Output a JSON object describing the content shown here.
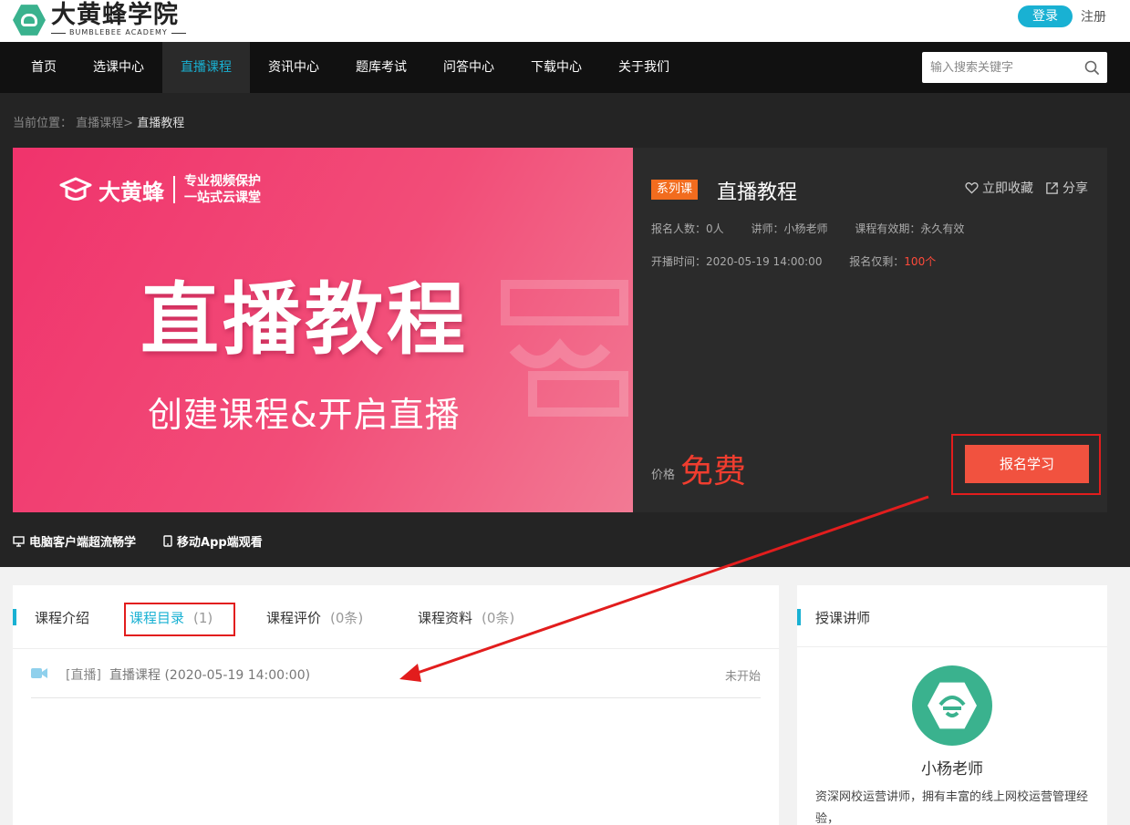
{
  "header": {
    "logo_cn": "大黄蜂学院",
    "logo_en": "BUMBLEBEE ACADEMY",
    "login_label": "登录",
    "register_label": "注册"
  },
  "nav": {
    "items": [
      {
        "label": "首页",
        "active": false
      },
      {
        "label": "选课中心",
        "active": false
      },
      {
        "label": "直播课程",
        "active": true
      },
      {
        "label": "资讯中心",
        "active": false
      },
      {
        "label": "题库考试",
        "active": false
      },
      {
        "label": "问答中心",
        "active": false
      },
      {
        "label": "下载中心",
        "active": false
      },
      {
        "label": "关于我们",
        "active": false
      }
    ],
    "search_placeholder": "输入搜索关键字"
  },
  "breadcrumb": {
    "prefix": "当前位置：",
    "parent": "直播课程>",
    "current": "直播教程"
  },
  "banner": {
    "brand": "大黄蜂",
    "tagline_1": "专业视频保护",
    "tagline_2": "一站式云课堂",
    "title": "直播教程",
    "subtitle": "创建课程&开启直播"
  },
  "course": {
    "series_tag": "系列课",
    "title": "直播教程",
    "favorite_label": "立即收藏",
    "share_label": "分享",
    "enrolled": "报名人数：0人",
    "teacher": "讲师：小杨老师",
    "validity": "课程有效期：永久有效",
    "start_time": "开播时间：2020-05-19 14:00:00",
    "remaining_label": "报名仅剩：",
    "remaining_value": "100个",
    "price_label": "价格",
    "price": "免费",
    "enroll_label": "报名学习"
  },
  "clients": {
    "pc": "电脑客户端超流畅学",
    "app": "移动App端观看"
  },
  "tabs": [
    {
      "label": "课程介绍",
      "count": ""
    },
    {
      "label": "课程目录",
      "count": "(1)"
    },
    {
      "label": "课程评价",
      "count": "(0条)"
    },
    {
      "label": "课程资料",
      "count": "(0条)"
    }
  ],
  "lessons": [
    {
      "tag": "[直播]",
      "title": "直播课程 (2020-05-19 14:00:00)",
      "status": "未开始"
    }
  ],
  "teacher_card": {
    "heading": "授课讲师",
    "name": "小杨老师",
    "desc": "资深网校运营讲师，拥有丰富的线上网校运营管理经验，"
  },
  "colors": {
    "accent": "#19b1d3",
    "brand_green": "#3ab28e",
    "price_red": "#f03d2f",
    "enroll_bg": "#f1523f",
    "series_orange": "#f26c1e",
    "annotation_red": "#e21d1d"
  },
  "icons": {
    "search": "search-icon",
    "favorite": "heart-icon",
    "share": "share-icon",
    "pc": "monitor-icon",
    "app": "phone-icon",
    "lesson": "video-camera-icon"
  }
}
